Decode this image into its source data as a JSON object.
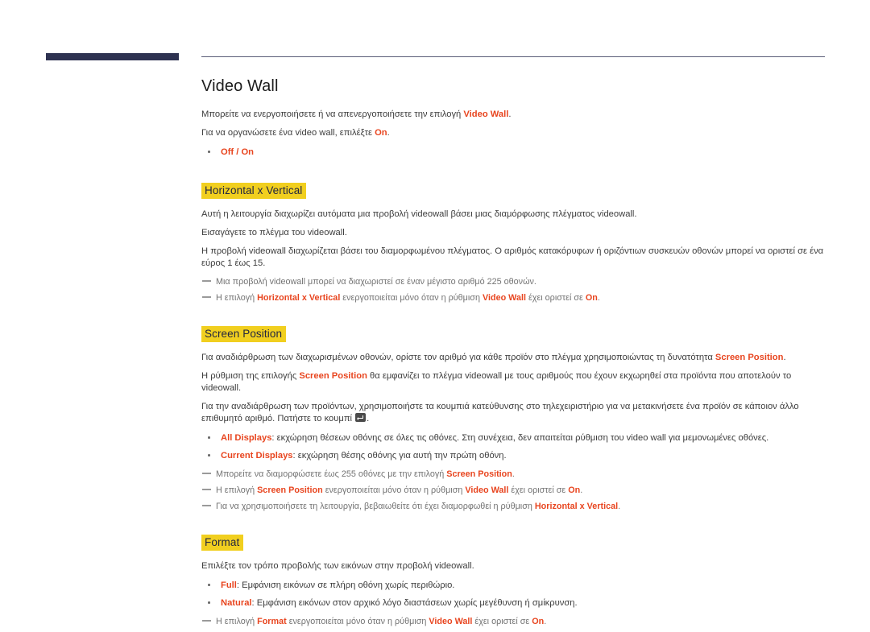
{
  "page": {
    "title": "Video Wall"
  },
  "video_wall": {
    "para1_pre": "Μπορείτε να ενεργοποιήσετε ή να απενεργοποιήσετε την επιλογή ",
    "para1_accent": "Video Wall",
    "para1_post": ".",
    "para2_pre": "Για να οργανώσετε ένα video wall, επιλέξτε ",
    "para2_accent": "On",
    "para2_post": ".",
    "option": "Off / On"
  },
  "horizontal_x_vertical": {
    "heading": "Horizontal x Vertical",
    "para1": "Αυτή η λειτουργία διαχωρίζει αυτόματα μια προβολή videowall βάσει μιας διαμόρφωσης πλέγματος videowall.",
    "para2": "Εισαγάγετε το πλέγμα του videowall.",
    "para3": "Η προβολή videowall διαχωρίζεται βάσει του διαμορφωμένου πλέγματος. Ο αριθμός κατακόρυφων ή οριζόντιων συσκευών οθονών μπορεί να οριστεί σε ένα εύρος 1 έως 15.",
    "note1": "Μια προβολή videowall μπορεί να διαχωριστεί σε έναν μέγιστο αριθμό 225 οθονών.",
    "note2_pre": "Η επιλογή ",
    "note2_accent1": "Horizontal x Vertical",
    "note2_mid": " ενεργοποιείται μόνο όταν η ρύθμιση ",
    "note2_accent2": "Video Wall",
    "note2_mid2": " έχει οριστεί σε ",
    "note2_accent3": "On",
    "note2_post": "."
  },
  "screen_position": {
    "heading": "Screen Position",
    "para1_pre": "Για αναδιάρθρωση των διαχωρισμένων οθονών, ορίστε τον αριθμό για κάθε προϊόν στο πλέγμα χρησιμοποιώντας τη δυνατότητα ",
    "para1_accent": "Screen Position",
    "para1_post": ".",
    "para2_pre": "Η ρύθμιση της επιλογής ",
    "para2_accent": "Screen Position",
    "para2_post": " θα εμφανίζει το πλέγμα videowall με τους αριθμούς που έχουν εκχωρηθεί στα προϊόντα που αποτελούν το videowall.",
    "para3_pre": "Για την αναδιάρθρωση των προϊόντων, χρησιμοποιήστε τα κουμπιά κατεύθυνσης στο τηλεχειριστήριο για να μετακινήσετε ένα προϊόν σε κάποιον άλλο επιθυμητό αριθμό. Πατήστε το κουμπί ",
    "para3_post": ".",
    "bullet1_label": "All Displays",
    "bullet1_text": ": εκχώρηση θέσεων οθόνης σε όλες τις οθόνες. Στη συνέχεια, δεν απαιτείται ρύθμιση του video wall για μεμονωμένες οθόνες.",
    "bullet2_label": "Current Displays",
    "bullet2_text": ": εκχώρηση θέσης οθόνης για αυτή την πρώτη οθόνη.",
    "note1_pre": "Μπορείτε να διαμορφώσετε έως 255 οθόνες με την επιλογή ",
    "note1_accent": "Screen Position",
    "note1_post": ".",
    "note2_pre": "Η επιλογή ",
    "note2_accent1": "Screen Position",
    "note2_mid": " ενεργοποιείται μόνο όταν η ρύθμιση ",
    "note2_accent2": "Video Wall",
    "note2_mid2": " έχει οριστεί σε ",
    "note2_accent3": "On",
    "note2_post": ".",
    "note3_pre": "Για να χρησιμοποιήσετε τη λειτουργία, βεβαιωθείτε ότι έχει διαμορφωθεί η ρύθμιση ",
    "note3_accent": "Horizontal x Vertical",
    "note3_post": "."
  },
  "format": {
    "heading": "Format",
    "para1": "Επιλέξτε τον τρόπο προβολής των εικόνων στην προβολή videowall.",
    "bullet1_label": "Full",
    "bullet1_text": ": Εμφάνιση εικόνων σε πλήρη οθόνη χωρίς περιθώριο.",
    "bullet2_label": "Natural",
    "bullet2_text": ": Εμφάνιση εικόνων στον αρχικό λόγο διαστάσεων χωρίς μεγέθυνση ή σμίκρυνση.",
    "note1_pre": "Η επιλογή ",
    "note1_accent1": "Format",
    "note1_mid": " ενεργοποιείται μόνο όταν η ρύθμιση ",
    "note1_accent2": "Video Wall",
    "note1_mid2": " έχει οριστεί σε ",
    "note1_accent3": "On",
    "note1_post": "."
  },
  "icons": {
    "enter_key": "enter-key-icon"
  },
  "colors": {
    "accent": "#e8451f",
    "highlight": "#f1cf1f",
    "heading_text": "#23263f",
    "deco_bar": "#2e3251"
  }
}
